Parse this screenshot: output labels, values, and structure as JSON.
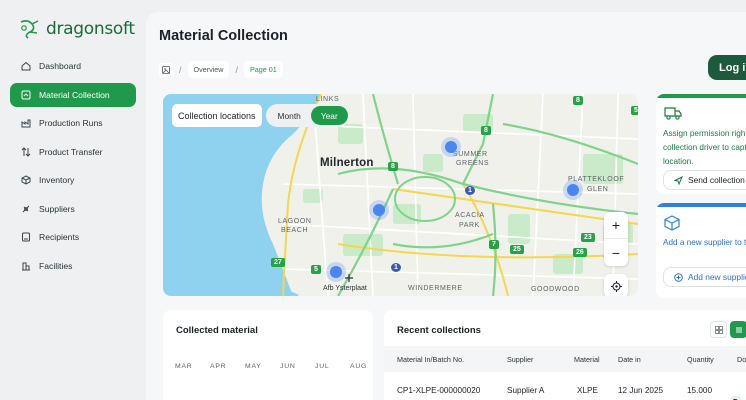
{
  "brand": {
    "name": "dragonsoft",
    "accent": "#1f9a4b",
    "dark": "#1d5a3c"
  },
  "sidebar": {
    "items": [
      {
        "label": "Dashboard",
        "icon": "dashboard-icon",
        "active": false
      },
      {
        "label": "Material Collection",
        "icon": "material-icon",
        "active": true
      },
      {
        "label": "Production Runs",
        "icon": "production-icon",
        "active": false
      },
      {
        "label": "Product Transfer",
        "icon": "transfer-icon",
        "active": false
      },
      {
        "label": "Inventory",
        "icon": "inventory-icon",
        "active": false
      },
      {
        "label": "Suppliers",
        "icon": "suppliers-icon",
        "active": false
      },
      {
        "label": "Recipients",
        "icon": "recipients-icon",
        "active": false
      },
      {
        "label": "Facilities",
        "icon": "facilities-icon",
        "active": false
      }
    ]
  },
  "header": {
    "title": "Material Collection",
    "breadcrumb": [
      "Overview",
      "Page 01"
    ],
    "login_label": "Log in"
  },
  "map": {
    "control_label": "Collection locations",
    "toggle": [
      "Month",
      "Year"
    ],
    "toggle_selected": "Year",
    "labels": [
      "LINKS",
      "Milnerton",
      "SUMMER",
      "GREENS",
      "PLATTEKLOOF",
      "GLEN",
      "LAGOON",
      "BEACH",
      "ACACIA",
      "PARK",
      "Afb Ysterplaat",
      "WINDERMERE",
      "GOODWOOD"
    ],
    "road_shields": [
      "8",
      "8",
      "8",
      "1",
      "27",
      "5",
      "1",
      "7",
      "25",
      "26",
      "23",
      "5"
    ],
    "zoom_in": "+",
    "zoom_out": "−"
  },
  "cards": {
    "driver": {
      "text": "Assign permission rights to collection driver to capture data on location.",
      "action": "Send collection link"
    },
    "supplier": {
      "text": "Add a new supplier to the chain",
      "action": "Add new supplier"
    }
  },
  "collected": {
    "title": "Collected material",
    "months": [
      "MAR",
      "APR",
      "MAY",
      "JUN",
      "JUL",
      "AUG"
    ]
  },
  "recent": {
    "title": "Recent collections",
    "columns": [
      "Material In/Batch No.",
      "Supplier",
      "Material",
      "Date in",
      "Quantity",
      "Do"
    ],
    "rows": [
      {
        "batch": "CP1-XLPE-000000020",
        "supplier": "Supplier A",
        "material": "XLPE",
        "date": "12 Jun 2025",
        "quantity": "15.000",
        "doc": "D"
      }
    ]
  }
}
